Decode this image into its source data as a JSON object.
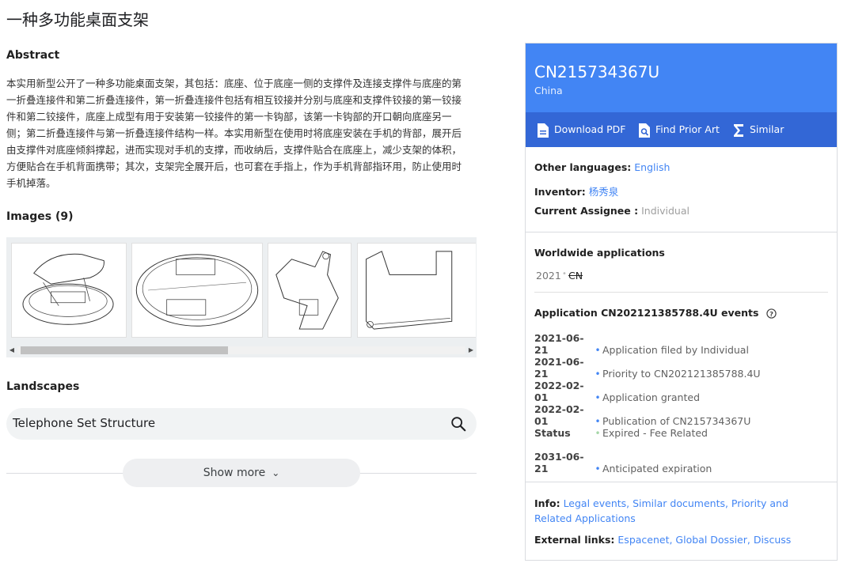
{
  "page": {
    "title": "一种多功能桌面支架"
  },
  "abstract": {
    "heading": "Abstract",
    "text": "本实用新型公开了一种多功能桌面支架，其包括：底座、位于底座一侧的支撑件及连接支撑件与底座的第一折叠连接件和第二折叠连接件，第一折叠连接件包括有相互铰接并分别与底座和支撑件铰接的第一铰接件和第二铰接件，底座上成型有用于安装第一铰接件的第一卡钩部，该第一卡钩部的开口朝向底座另一侧；第二折叠连接件与第一折叠连接件结构一样。本实用新型在使用时将底座安装在手机的背部，展开后由支撑件对底座倾斜撑起，进而实现对手机的支撑，而收纳后，支撑件贴合在底座上，减少支架的体积，方便贴合在手机背面携带；其次，支架完全展开后，也可套在手指上，作为手机背部指环用，防止使用时手机掉落。"
  },
  "images": {
    "heading": "Images (9)"
  },
  "landscapes": {
    "heading": "Landscapes",
    "item": "Telephone Set Structure"
  },
  "show_more": {
    "label": "Show more"
  },
  "patent": {
    "number": "CN215734367U",
    "country": "China",
    "actions": {
      "download": "Download PDF",
      "prior_art": "Find Prior Art",
      "similar": "Similar"
    },
    "other_languages_label": "Other languages:",
    "other_languages_value": "English",
    "inventor_label": "Inventor:",
    "inventor_value": "杨秀泉",
    "assignee_label": "Current Assignee :",
    "assignee_value": "Individual"
  },
  "worldwide": {
    "heading": "Worldwide applications",
    "year": "2021",
    "country": "CN"
  },
  "events": {
    "heading": "Application CN202121385788.4U events",
    "items": [
      {
        "date": "2021-06-21",
        "desc": "Application filed by Individual"
      },
      {
        "date": "2021-06-21",
        "desc": "Priority to CN202121385788.4U"
      },
      {
        "date": "2022-02-01",
        "desc": "Application granted"
      },
      {
        "date": "2022-02-01",
        "desc": "Publication of CN215734367U"
      },
      {
        "date": "Status",
        "desc": "Expired - Fee Related"
      },
      {
        "date": "2031-06-21",
        "desc": "Anticipated expiration"
      }
    ]
  },
  "info": {
    "label": "Info:",
    "links": "Legal events, Similar documents, Priority and Related Applications",
    "external_label": "External links:",
    "external_links": "Espacenet, Global Dossier, Discuss"
  }
}
